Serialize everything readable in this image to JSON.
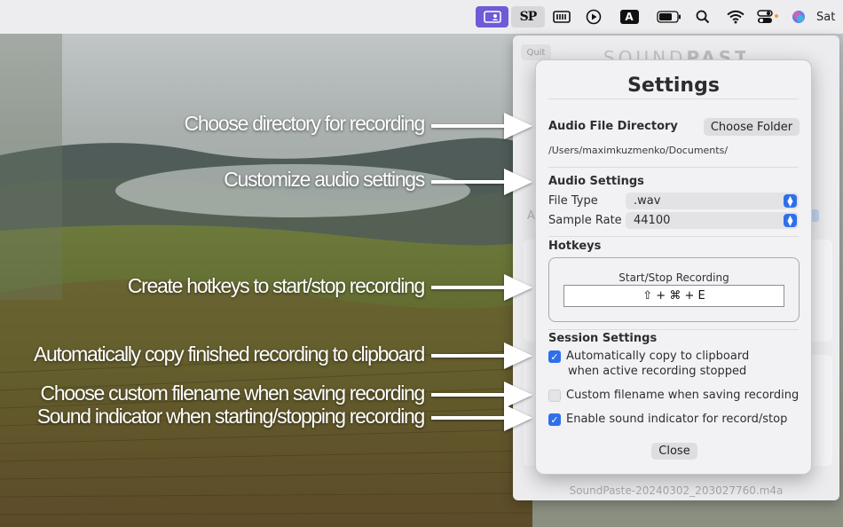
{
  "menubar": {
    "icons": [
      "screen-share-icon",
      "soundpaste-icon",
      "keyboard-brightness-icon",
      "play-icon",
      "text-input-icon",
      "battery-icon",
      "search-icon",
      "wifi-icon",
      "control-center-icon",
      "siri-icon"
    ],
    "soundpaste_label": "SP",
    "input_label": "A",
    "clock": "Sat"
  },
  "popover": {
    "quit_label": "Quit",
    "brand_light": "SOUND",
    "brand_bold": "PASTE",
    "partial_label": "A",
    "recording_file": "SoundPaste-20240302_203027760.m4a"
  },
  "settings": {
    "title": "Settings",
    "audio_dir": {
      "heading": "Audio File Directory",
      "button": "Choose Folder",
      "path": "/Users/maximkuzmenko/Documents/"
    },
    "audio": {
      "heading": "Audio Settings",
      "file_type_label": "File Type",
      "file_type_value": ".wav",
      "sample_rate_label": "Sample Rate",
      "sample_rate_value": "44100"
    },
    "hotkeys": {
      "heading": "Hotkeys",
      "label": "Start/Stop Recording",
      "value": "⇧ + ⌘ + E"
    },
    "session": {
      "heading": "Session Settings",
      "copy_line1": "Automatically copy to clipboard",
      "copy_line2": "when active recording stopped",
      "copy_checked": true,
      "filename_label": "Custom filename when saving recording",
      "filename_checked": false,
      "sound_label": "Enable sound indicator for record/stop",
      "sound_checked": true
    },
    "close_button": "Close"
  },
  "annotations": [
    "Choose directory for recording",
    "Customize audio settings",
    "Create hotkeys to start/stop recording",
    "Automatically copy finished recording to clipboard",
    "Choose custom filename when saving recording",
    "Sound indicator when starting/stopping recording"
  ],
  "colors": {
    "accent": "#2f6fea",
    "menubar_active": "#6e5bd6"
  }
}
